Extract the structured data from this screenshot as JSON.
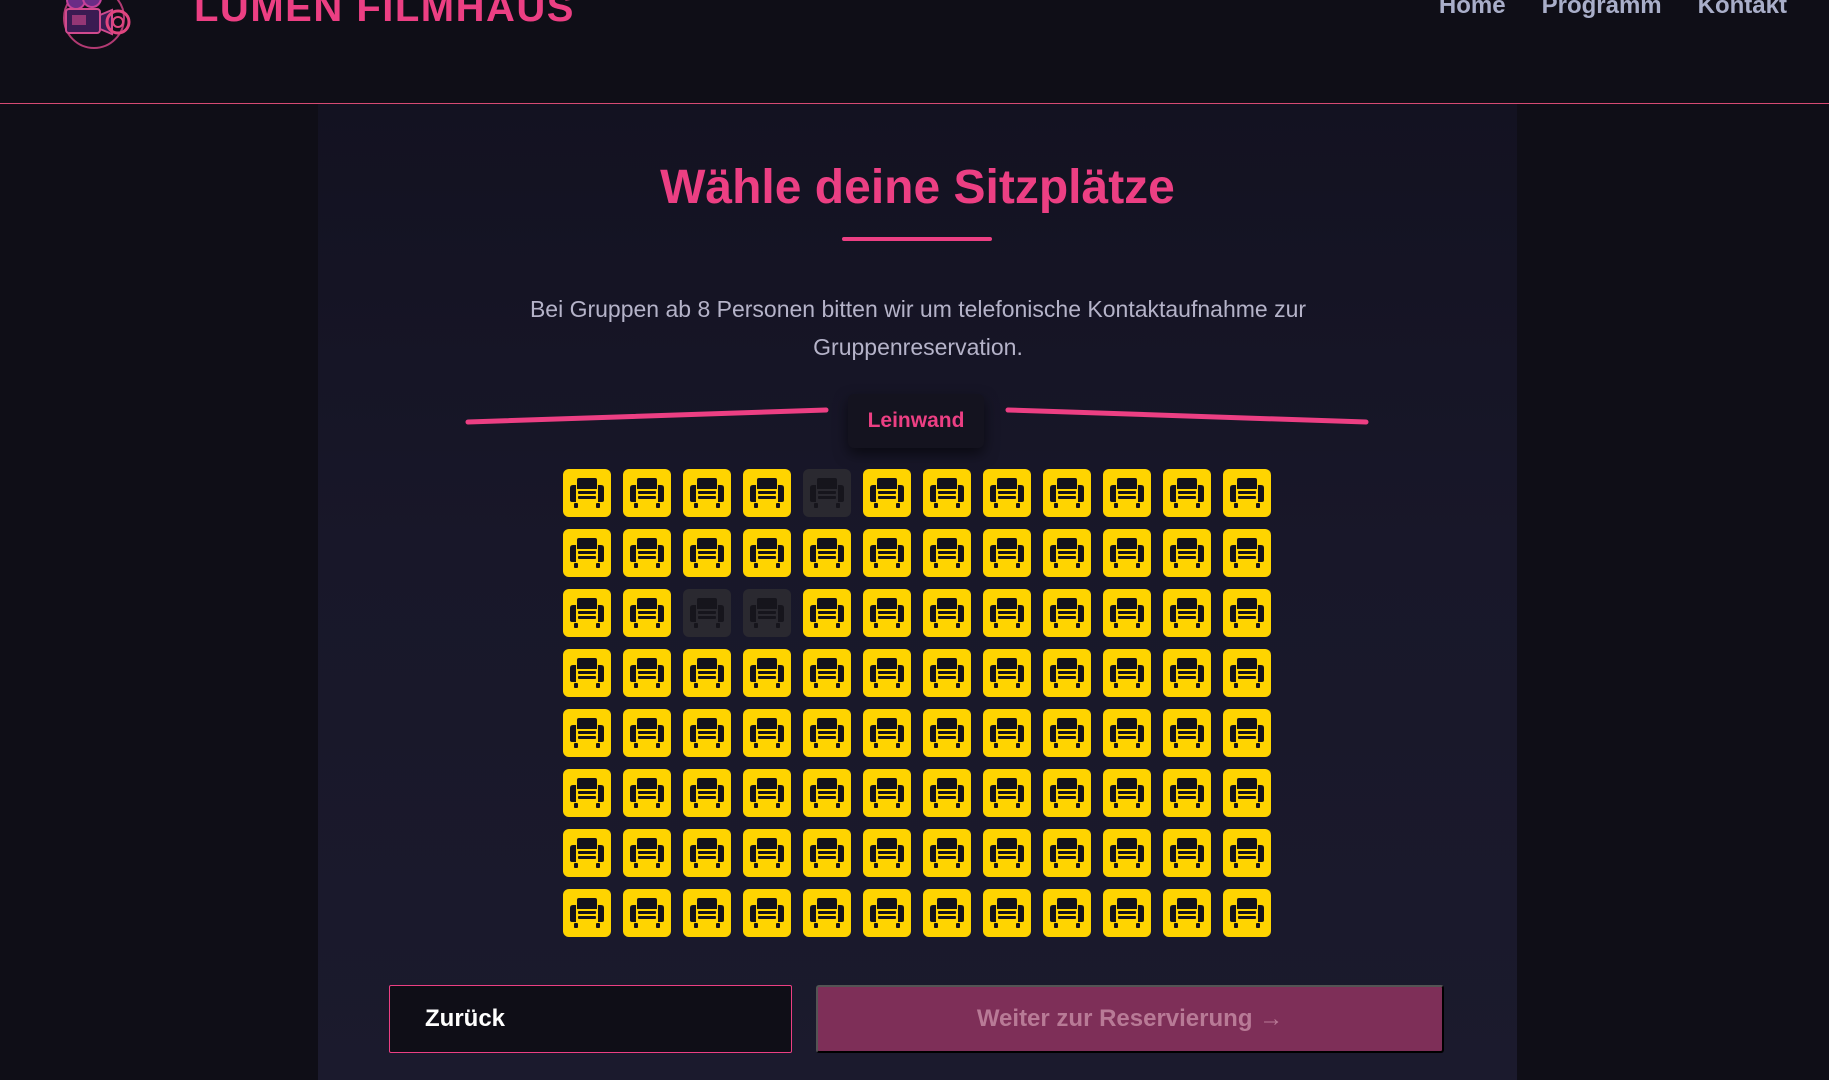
{
  "header": {
    "brand": "LUMEN FILMHAUS",
    "nav": [
      "Home",
      "Programm",
      "Kontakt"
    ]
  },
  "seat_selection": {
    "title": "Wähle deine Sitzplätze",
    "notice": "Bei Gruppen ab 8 Personen bitten wir um telefonische Kontaktaufnahme zur Gruppenreservation.",
    "screen_label": "Leinwand",
    "rows": 8,
    "seats_per_row": 12,
    "occupied": [
      [
        1,
        5
      ],
      [
        3,
        3
      ],
      [
        3,
        4
      ]
    ]
  },
  "actions": {
    "back_label": "Zurück",
    "next_label": "Weiter zur Reservierung →"
  },
  "colors": {
    "accent": "#ec3f83",
    "seat_available": "#ffd400",
    "seat_occupied": "#2a2930",
    "next_button": "#7e2f58"
  },
  "icons": {
    "logo": "film-camera-icon",
    "seat": "armchair-icon"
  }
}
